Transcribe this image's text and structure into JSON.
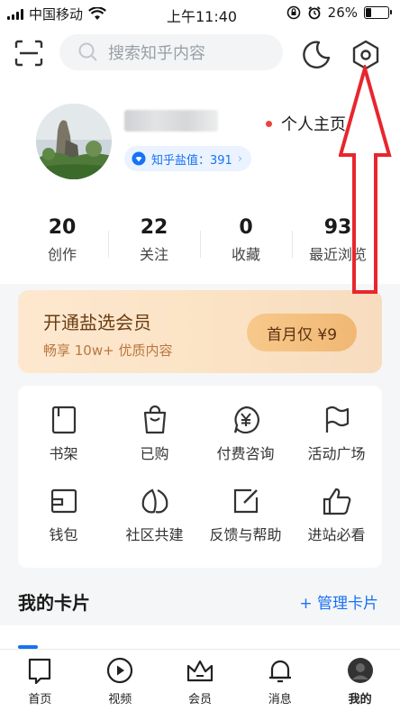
{
  "status_bar": {
    "carrier": "中国移动",
    "time": "上午11:40",
    "battery": "26%",
    "battery_level": 0.26
  },
  "header": {
    "search_placeholder": "搜索知乎内容"
  },
  "profile": {
    "homepage_link": "个人主页",
    "salt_badge": "知乎盐值：391"
  },
  "stats": [
    {
      "num": "20",
      "label": "创作"
    },
    {
      "num": "22",
      "label": "关注"
    },
    {
      "num": "0",
      "label": "收藏"
    },
    {
      "num": "93",
      "label": "最近浏览"
    }
  ],
  "vip": {
    "title": "开通盐选会员",
    "subtitle": "畅享 10w+ 优质内容",
    "button": "首月仅 ¥9"
  },
  "grid": [
    "书架",
    "已购",
    "付费咨询",
    "活动广场",
    "钱包",
    "社区共建",
    "反馈与帮助",
    "进站必看"
  ],
  "cards": {
    "title": "我的卡片",
    "manage": "+ 管理卡片"
  },
  "nav": [
    "首页",
    "视频",
    "会员",
    "消息",
    "我的"
  ],
  "colors": {
    "accent": "#1772f6",
    "annotation_arrow": "#e8262d"
  }
}
